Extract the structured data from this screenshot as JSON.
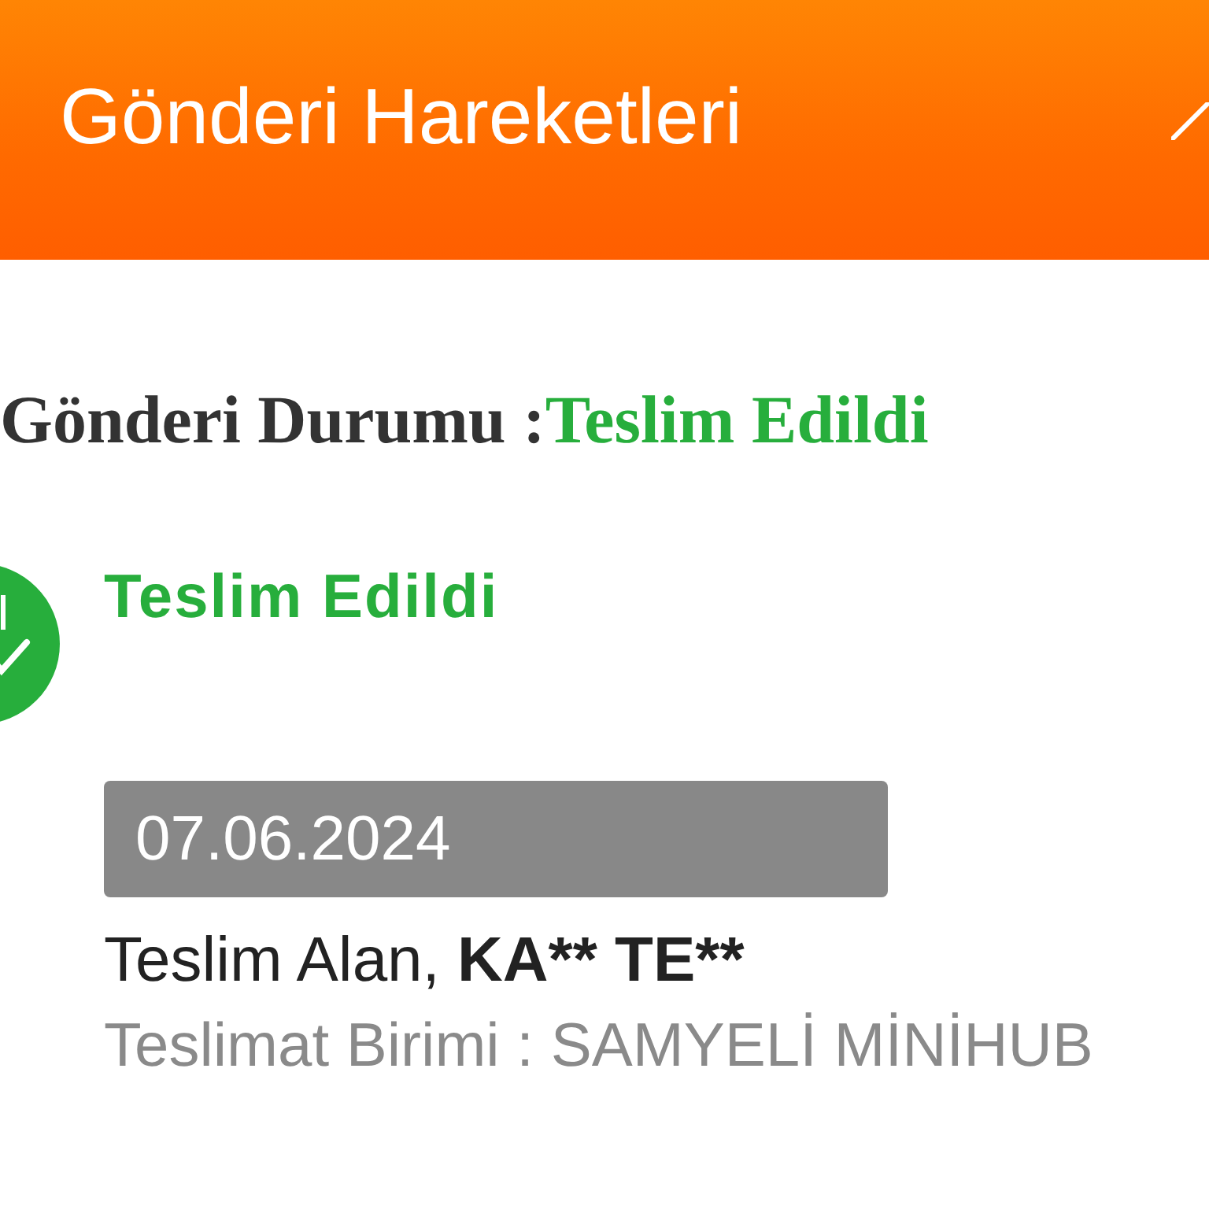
{
  "header": {
    "title": "Gönderi Hareketleri"
  },
  "status": {
    "label": "Gönderi Durumu :",
    "value": "Teslim Edildi",
    "kind": "delivered"
  },
  "events": [
    {
      "kind": "delivered",
      "title": "Teslim Edildi",
      "date": "07.06.2024",
      "receiver_label": "Teslim Alan,",
      "receiver_name": "KA** TE**",
      "unit": "Teslimat Birimi : SAMYELİ MİNİHUB"
    }
  ]
}
